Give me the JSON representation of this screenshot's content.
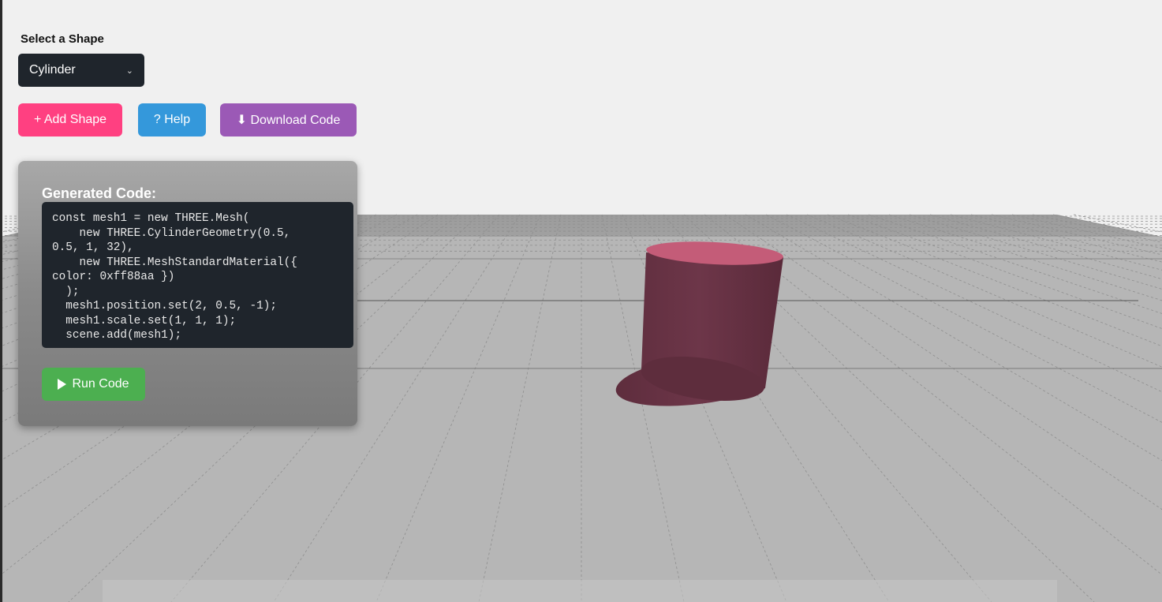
{
  "controls": {
    "shape_label": "Select a Shape",
    "shape_select_value": "Cylinder",
    "add_shape_label": "+ Add Shape",
    "help_label": "? Help",
    "download_label": "⬇ Download Code"
  },
  "code_panel": {
    "title": "Generated Code:",
    "code": "const mesh1 = new THREE.Mesh(\n    new THREE.CylinderGeometry(0.5,\n0.5, 1, 32),\n    new THREE.MeshStandardMaterial({\ncolor: 0xff88aa })\n  );\n  mesh1.position.set(2, 0.5, -1);\n  mesh1.scale.set(1, 1, 1);\n  scene.add(mesh1);",
    "run_label": "Run Code"
  },
  "icons": {
    "select_chevron": "chevron-down-icon",
    "run": "play-icon"
  },
  "colors": {
    "add_button": "#ff4081",
    "help_button": "#3498db",
    "download_button": "#9b59b6",
    "run_button": "#4caf50",
    "cylinder_top": "#c45c78",
    "cylinder_side": "#6b3547",
    "ground": "#b8b8b8"
  }
}
